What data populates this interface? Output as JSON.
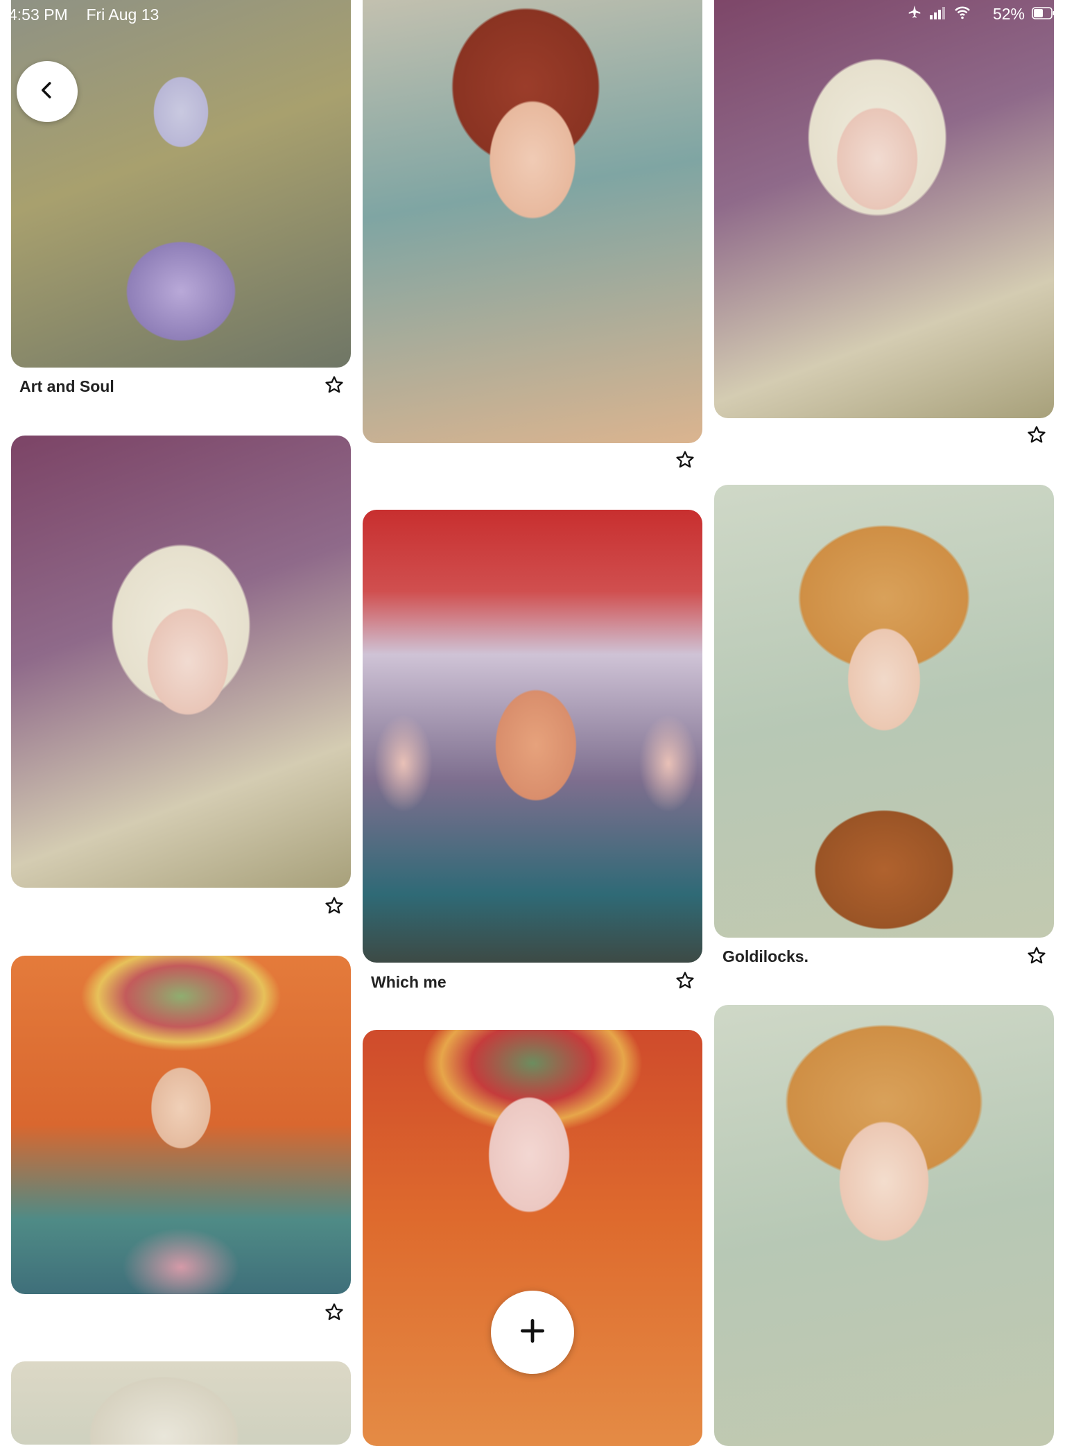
{
  "status_bar": {
    "time": "4:53 PM",
    "date": "Fri Aug 13",
    "battery": "52%",
    "icons": [
      "airplane-icon",
      "cellular-signal-icon",
      "wifi-icon",
      "battery-icon"
    ]
  },
  "navigation": {
    "back_icon": "chevron-left-icon",
    "add_icon": "plus-icon"
  },
  "pins": [
    {
      "title": "Art and Soul"
    },
    {
      "title": ""
    },
    {
      "title": ""
    },
    {
      "title": ""
    },
    {
      "title": "Which me"
    },
    {
      "title": "Goldilocks."
    },
    {
      "title": ""
    },
    {
      "title": ""
    },
    {
      "title": ""
    },
    {
      "title": ""
    }
  ],
  "colors": {
    "background": "#ffffff",
    "text": "#222222",
    "icon": "#111111"
  }
}
